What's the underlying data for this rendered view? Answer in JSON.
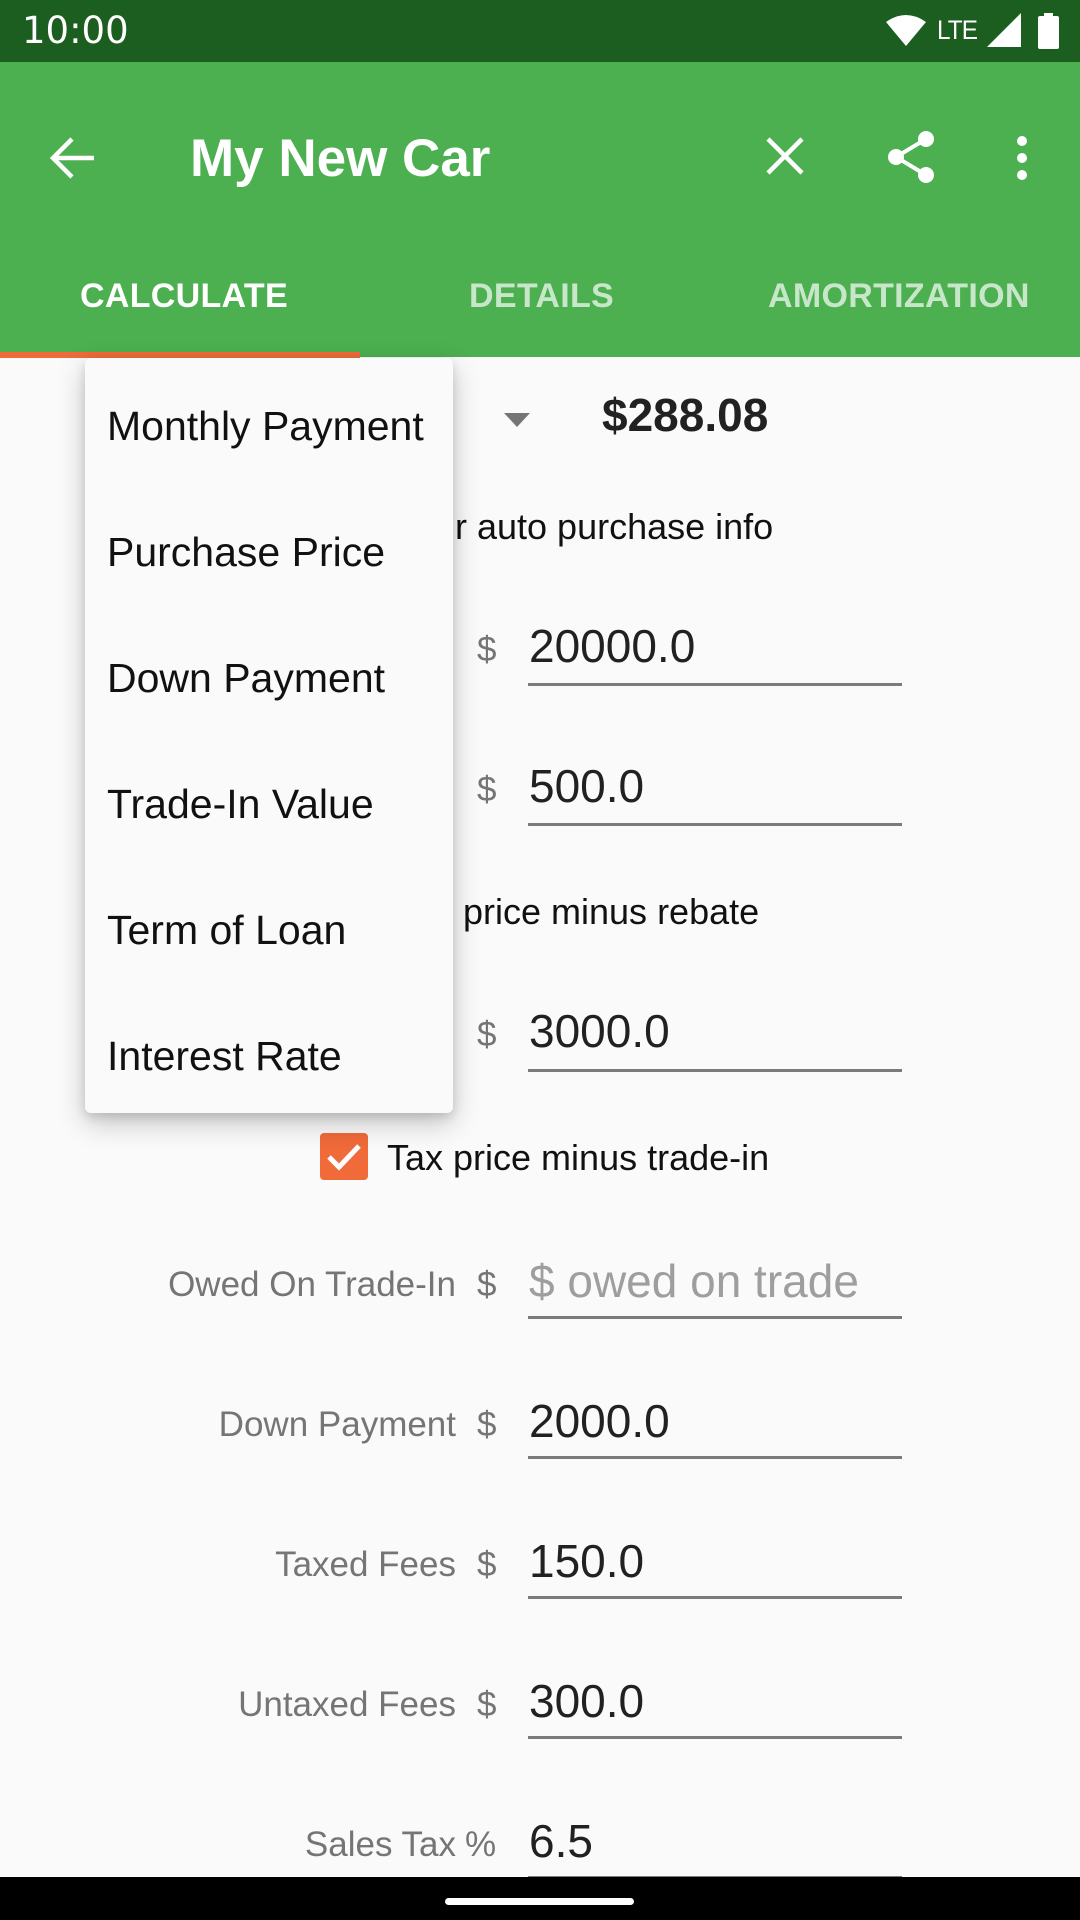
{
  "status_bar": {
    "time": "10:00",
    "network": "LTE",
    "icons": [
      "wifi-icon",
      "lte-icon",
      "signal-icon",
      "battery-icon"
    ]
  },
  "app_bar": {
    "title": "My New Car",
    "back_icon": "arrow-left-icon",
    "actions": [
      "close-icon",
      "share-icon",
      "more-vert-icon"
    ],
    "color": "#4caf50",
    "status_color": "#1b5e20"
  },
  "tabs": [
    {
      "label": "CALCULATE",
      "active": true
    },
    {
      "label": "DETAILS",
      "active": false
    },
    {
      "label": "AMORTIZATION",
      "active": false
    }
  ],
  "accent_color": "#f06a3a",
  "calculate": {
    "result": "$288.08",
    "intro_text_visible": "r auto purchase info",
    "rebate_text_visible": "price minus rebate",
    "fields_partial": [
      {
        "currency": "$",
        "value": "20000.0"
      },
      {
        "currency": "$",
        "value": "500.0"
      },
      {
        "currency": "$",
        "value": "3000.0"
      }
    ],
    "tax_trade_checkbox": {
      "label": "Tax price minus trade-in",
      "checked": true
    },
    "fields": [
      {
        "label": "Owed On Trade-In",
        "currency": "$",
        "value": "",
        "placeholder": "$ owed on trade"
      },
      {
        "label": "Down Payment",
        "currency": "$",
        "value": "2000.0"
      },
      {
        "label": "Taxed Fees",
        "currency": "$",
        "value": "150.0"
      },
      {
        "label": "Untaxed Fees",
        "currency": "$",
        "value": "300.0"
      },
      {
        "label": "Sales Tax",
        "currency": "%",
        "value": "6.5"
      }
    ]
  },
  "dropdown_menu": {
    "items": [
      "Monthly Payment",
      "Purchase Price",
      "Down Payment",
      "Trade-In Value",
      "Term of Loan",
      "Interest Rate"
    ]
  }
}
